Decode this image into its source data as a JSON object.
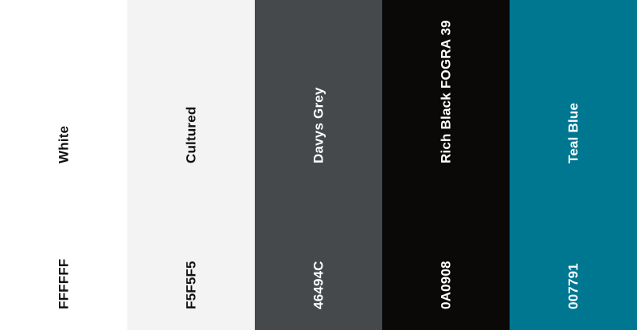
{
  "palette": {
    "swatches": [
      {
        "name": "White",
        "hex": "FFFFFF",
        "color": "#FFFFFF",
        "text_color": "#111111"
      },
      {
        "name": "Cultured",
        "hex": "F5F5F5",
        "color": "#F3F3F3",
        "text_color": "#111111"
      },
      {
        "name": "Davys Grey",
        "hex": "46494C",
        "color": "#46494C",
        "text_color": "#FFFFFF"
      },
      {
        "name": "Rich Black FOGRA 39",
        "hex": "0A0908",
        "color": "#0A0908",
        "text_color": "#FFFFFF"
      },
      {
        "name": "Teal Blue",
        "hex": "007791",
        "color": "#007791",
        "text_color": "#FFFFFF"
      }
    ]
  }
}
